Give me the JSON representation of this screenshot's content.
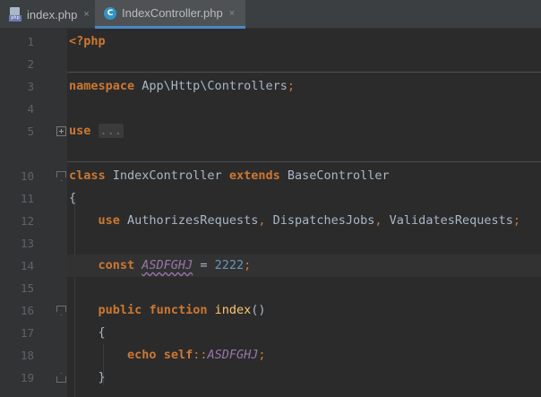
{
  "tabs": [
    {
      "label": "index.php",
      "icon": "php-file-icon",
      "close": "×"
    },
    {
      "label": "IndexController.php",
      "icon": "php-class-icon",
      "close": "×",
      "active": true
    }
  ],
  "icon_glyphs": {
    "php_badge": "php",
    "class_letter": "C"
  },
  "line_numbers": [
    "1",
    "2",
    "3",
    "4",
    "5",
    "10",
    "11",
    "12",
    "13",
    "14",
    "15",
    "16",
    "17",
    "18",
    "19"
  ],
  "code": {
    "l1_open": "<?php",
    "l3_kw": "namespace",
    "l3_ns": " App\\Http\\Controllers",
    "l3_semi": ";",
    "l5_kw": "use",
    "l5_fold": "...",
    "l10_kw1": "class",
    "l10_name": " IndexController ",
    "l10_kw2": "extends",
    "l10_base": " BaseController",
    "l11": "{",
    "l12_kw": "use",
    "l12_t1": " AuthorizesRequests",
    "l12_c1": ",",
    "l12_t2": " DispatchesJobs",
    "l12_c2": ",",
    "l12_t3": " ValidatesRequests",
    "l12_semi": ";",
    "l14_kw": "const",
    "l14_name": "ASDFGHJ",
    "l14_eq": " = ",
    "l14_val": "2222",
    "l14_semi": ";",
    "l16_kw1": "public",
    "l16_kw2": "function",
    "l16_fn": "index",
    "l16_paren": "()",
    "l17": "{",
    "l18_kw1": "echo",
    "l18_kw2": "self",
    "l18_op": "::",
    "l18_const": "ASDFGHJ",
    "l18_semi": ";",
    "l19": "}"
  }
}
